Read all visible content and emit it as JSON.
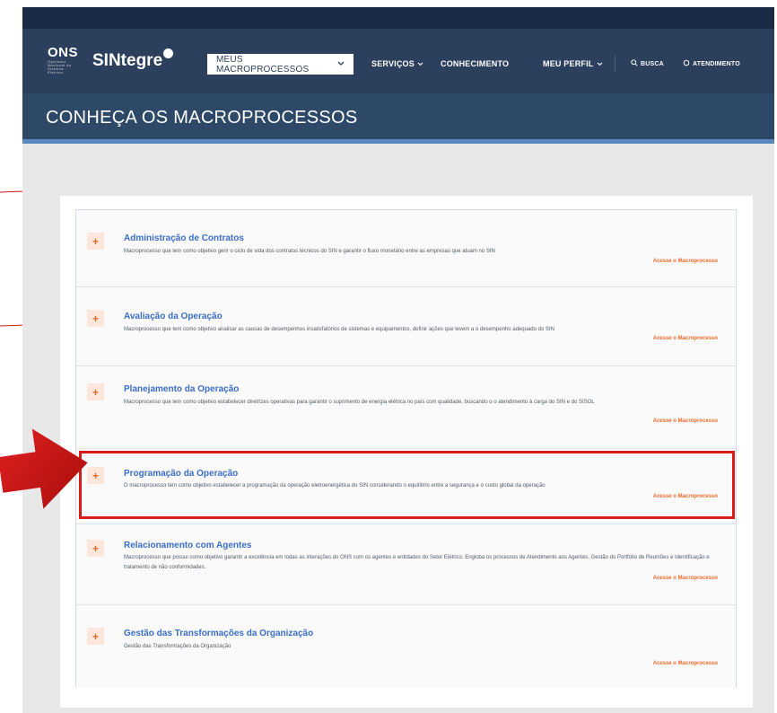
{
  "header": {
    "ons_logo": "ONS",
    "ons_subtitle": "Operador Nacional do Sistema Elétrico",
    "sintegre_logo": "SINtegre",
    "nav": {
      "macro": "MEUS MACROPROCESSOS",
      "servicos": "SERVIÇOS",
      "conhecimento": "CONHECIMENTO",
      "perfil": "MEU PERFIL",
      "busca": "BUSCA",
      "atendimento": "ATENDIMENTO"
    }
  },
  "page_title": "CONHEÇA OS MACROPROCESSOS",
  "macroprocessos": [
    {
      "title": "Administração de Contratos",
      "description": "Macroprocesso que tem como objetivo gerir o ciclo de vida dos contratos técnicos do SIN e garantir o fluxo monetário entre as empresas que atuam no SIN",
      "link": "Acesse o Macroprocesso"
    },
    {
      "title": "Avaliação da Operação",
      "description": "Macroprocesso que tem como objetivo analisar as causas de  desempenhos  insatisfatórios de sistemas e equipamentos,  definir ações que levem a o desempenho  adequado do SIN",
      "link": "Acesse o Macroprocesso"
    },
    {
      "title": "Planejamento da Operação",
      "description": "Macroprocesso que tem como objetivo estabelecer diretrizes operativas para garantir o suprimento de energia elétrica no país com qualidade, buscando o o atendimento à carga do SIN e do SISOL",
      "link": "Acesse o Macroprocesso"
    },
    {
      "title": "Programação da Operação",
      "description": "O macroprocesso tem como objetivo estabelecer a programação da operação eletroenergética do SIN considerando o equilíbrio entre a segurança e o custo global da operação",
      "link": "Acesse o Macroprocesso"
    },
    {
      "title": "Relacionamento com Agentes",
      "description": "Macroprocesso que possui como objetivo garantir a excelência em todas as interações do ONS com os agentes e entidades do Setor Elétrico. Engloba os processos de Atendimento aos Agentes, Gestão do Portfólio de Reuniões e Identificação e tratamento de não conformidades.",
      "link": "Acesse o Macroprocesso"
    },
    {
      "title": "Gestão das Transformações da Organização",
      "description": "Gestão das Transformações da Organização",
      "link": "Acesse o Macroprocesso"
    }
  ],
  "icons": {
    "expand": "+",
    "chevron": "⌄",
    "search": "search-icon",
    "chat": "chat-icon"
  },
  "colors": {
    "navbar": "#2c3f5c",
    "title_bar": "#2e4868",
    "accent_blue": "#3b6ec4",
    "accent_orange": "#ef6b2b",
    "highlight_red": "#d71c1c"
  }
}
